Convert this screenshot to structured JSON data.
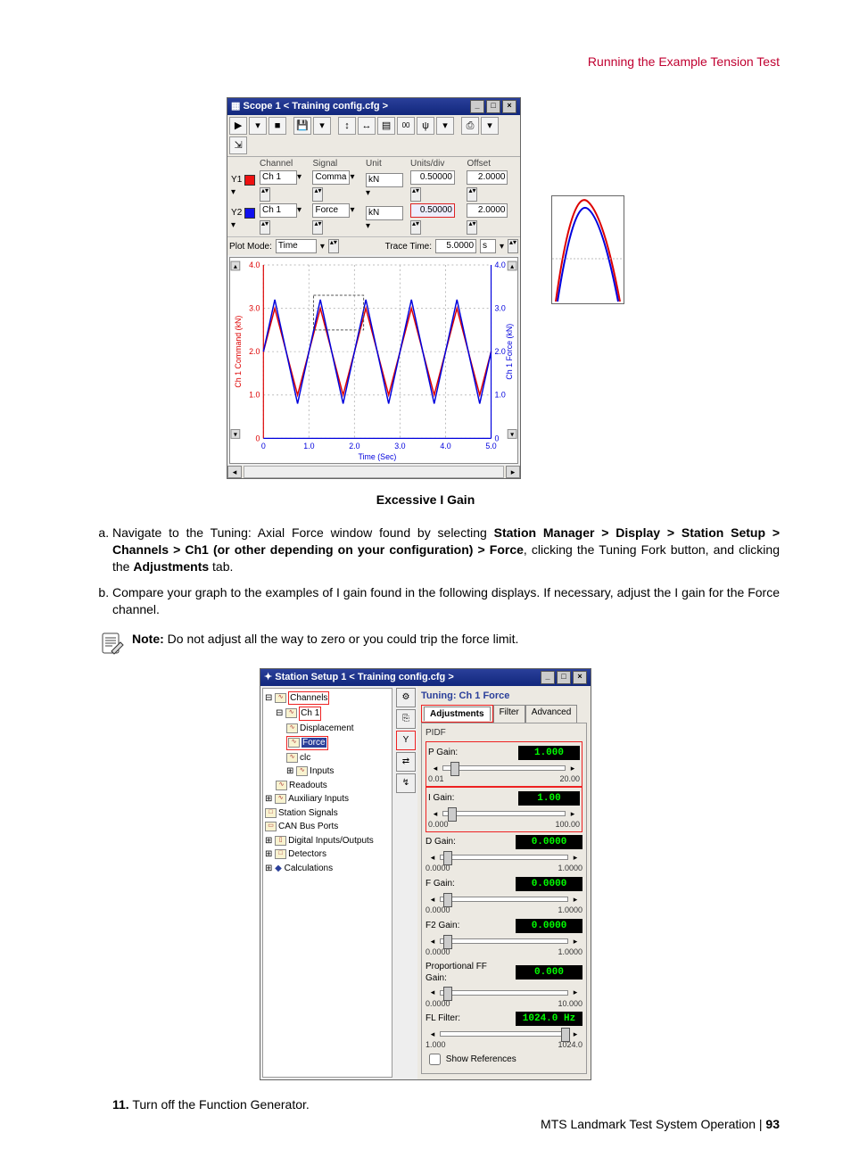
{
  "header": {
    "running": "Running the Example Tension Test"
  },
  "scope": {
    "title": "Scope 1 < Training config.cfg >",
    "columns": [
      "Channel",
      "Signal",
      "Unit",
      "Units/div",
      "Offset"
    ],
    "rows": {
      "y1": {
        "label": "Y1",
        "channel": "Ch 1",
        "signal": "Comma",
        "unit": "kN",
        "upd": "0.50000",
        "offset": "2.0000"
      },
      "y2": {
        "label": "Y2",
        "channel": "Ch 1",
        "signal": "Force",
        "unit": "kN",
        "upd": "0.50000",
        "offset": "2.0000"
      }
    },
    "plotmode_label": "Plot Mode:",
    "plotmode_value": "Time",
    "tracetime_label": "Trace Time:",
    "tracetime_value": "5.0000",
    "tracetime_unit": "s",
    "yaxis_left": "Ch 1 Command (kN)",
    "yaxis_right": "Ch 1 Force (kN)",
    "xaxis": "Time (Sec)",
    "yticks": [
      "4.0",
      "3.0",
      "2.0",
      "1.0",
      "0"
    ],
    "xticks": [
      "0",
      "1.0",
      "2.0",
      "3.0",
      "4.0",
      "5.0"
    ]
  },
  "fig_caption": "Excessive I Gain",
  "list": {
    "a": {
      "pre": "Navigate to the Tuning: Axial Force window found by selecting ",
      "bold1": "Station Manager > Display > Station Setup > Channels > Ch1 (or other depending on your configuration) > Force",
      "mid": ", clicking the Tuning Fork button, and clicking the ",
      "bold2": "Adjustments",
      "post": " tab."
    },
    "b": "Compare your graph to the examples of I gain found in the following displays. If necessary, adjust the I gain for the Force channel."
  },
  "note": {
    "label": "Note:",
    "text": " Do not adjust all the way to zero or you could trip the force limit."
  },
  "station": {
    "title": "Station Setup 1 < Training config.cfg >",
    "tree": {
      "channels": "Channels",
      "ch1": "Ch 1",
      "displacement": "Displacement",
      "force": "Force",
      "clc": "clc",
      "inputs": "Inputs",
      "readouts": "Readouts",
      "aux": "Auxiliary Inputs",
      "sig": "Station Signals",
      "can": "CAN Bus Ports",
      "digio": "Digital Inputs/Outputs",
      "det": "Detectors",
      "calc": "Calculations"
    },
    "panel": {
      "title": "Tuning: Ch 1 Force",
      "tabs": {
        "adj": "Adjustments",
        "filter": "Filter",
        "adv": "Advanced"
      },
      "group": "PIDF",
      "gains": {
        "p": {
          "label": "P Gain:",
          "value": "1.000",
          "min": "0.01",
          "max": "20.00",
          "thumb": 6
        },
        "i": {
          "label": "I Gain:",
          "value": "1.00",
          "min": "0.000",
          "max": "100.00",
          "thumb": 4
        },
        "d": {
          "label": "D Gain:",
          "value": "0.0000",
          "min": "0.0000",
          "max": "1.0000",
          "thumb": 2
        },
        "f": {
          "label": "F Gain:",
          "value": "0.0000",
          "min": "0.0000",
          "max": "1.0000",
          "thumb": 2
        },
        "f2": {
          "label": "F2 Gain:",
          "value": "0.0000",
          "min": "0.0000",
          "max": "1.0000",
          "thumb": 2
        },
        "pff": {
          "label": "Proportional FF Gain:",
          "value": "0.000",
          "min": "0.0000",
          "max": "10.000",
          "thumb": 2
        },
        "fl": {
          "label": "FL Filter:",
          "value": "1024.0 Hz",
          "min": "1.000",
          "max": "1024.0",
          "thumb": 95
        }
      },
      "showrefs": "Show References"
    }
  },
  "step11": {
    "num": "11.",
    "text": "Turn off the Function Generator."
  },
  "footer": {
    "doc": "MTS Landmark Test System Operation",
    "sep": " | ",
    "page": "93"
  },
  "chart_data": {
    "type": "line",
    "title": "Excessive I Gain",
    "xlabel": "Time (Sec)",
    "ylabel_left": "Ch 1 Command (kN)",
    "ylabel_right": "Ch 1 Force (kN)",
    "xlim": [
      0,
      5.0
    ],
    "ylim": [
      0,
      4.0
    ],
    "x": [
      0.0,
      0.25,
      0.5,
      0.75,
      1.0,
      1.25,
      1.5,
      1.75,
      2.0,
      2.25,
      2.5,
      2.75,
      3.0,
      3.25,
      3.5,
      3.75,
      4.0,
      4.25,
      4.5,
      4.75,
      5.0
    ],
    "series": [
      {
        "name": "Ch 1 Command (kN)",
        "color": "#d00",
        "values": [
          2.0,
          3.0,
          2.0,
          1.0,
          2.0,
          3.0,
          2.0,
          1.0,
          2.0,
          3.0,
          2.0,
          1.0,
          2.0,
          3.0,
          2.0,
          1.0,
          2.0,
          3.0,
          2.0,
          1.0,
          2.0
        ]
      },
      {
        "name": "Ch 1 Force (kN)",
        "color": "#00d",
        "values": [
          2.0,
          3.2,
          2.0,
          0.8,
          2.0,
          3.2,
          2.0,
          0.8,
          2.0,
          3.2,
          2.0,
          0.8,
          2.0,
          3.2,
          2.0,
          0.8,
          2.0,
          3.2,
          2.0,
          0.8,
          2.0
        ]
      }
    ]
  }
}
